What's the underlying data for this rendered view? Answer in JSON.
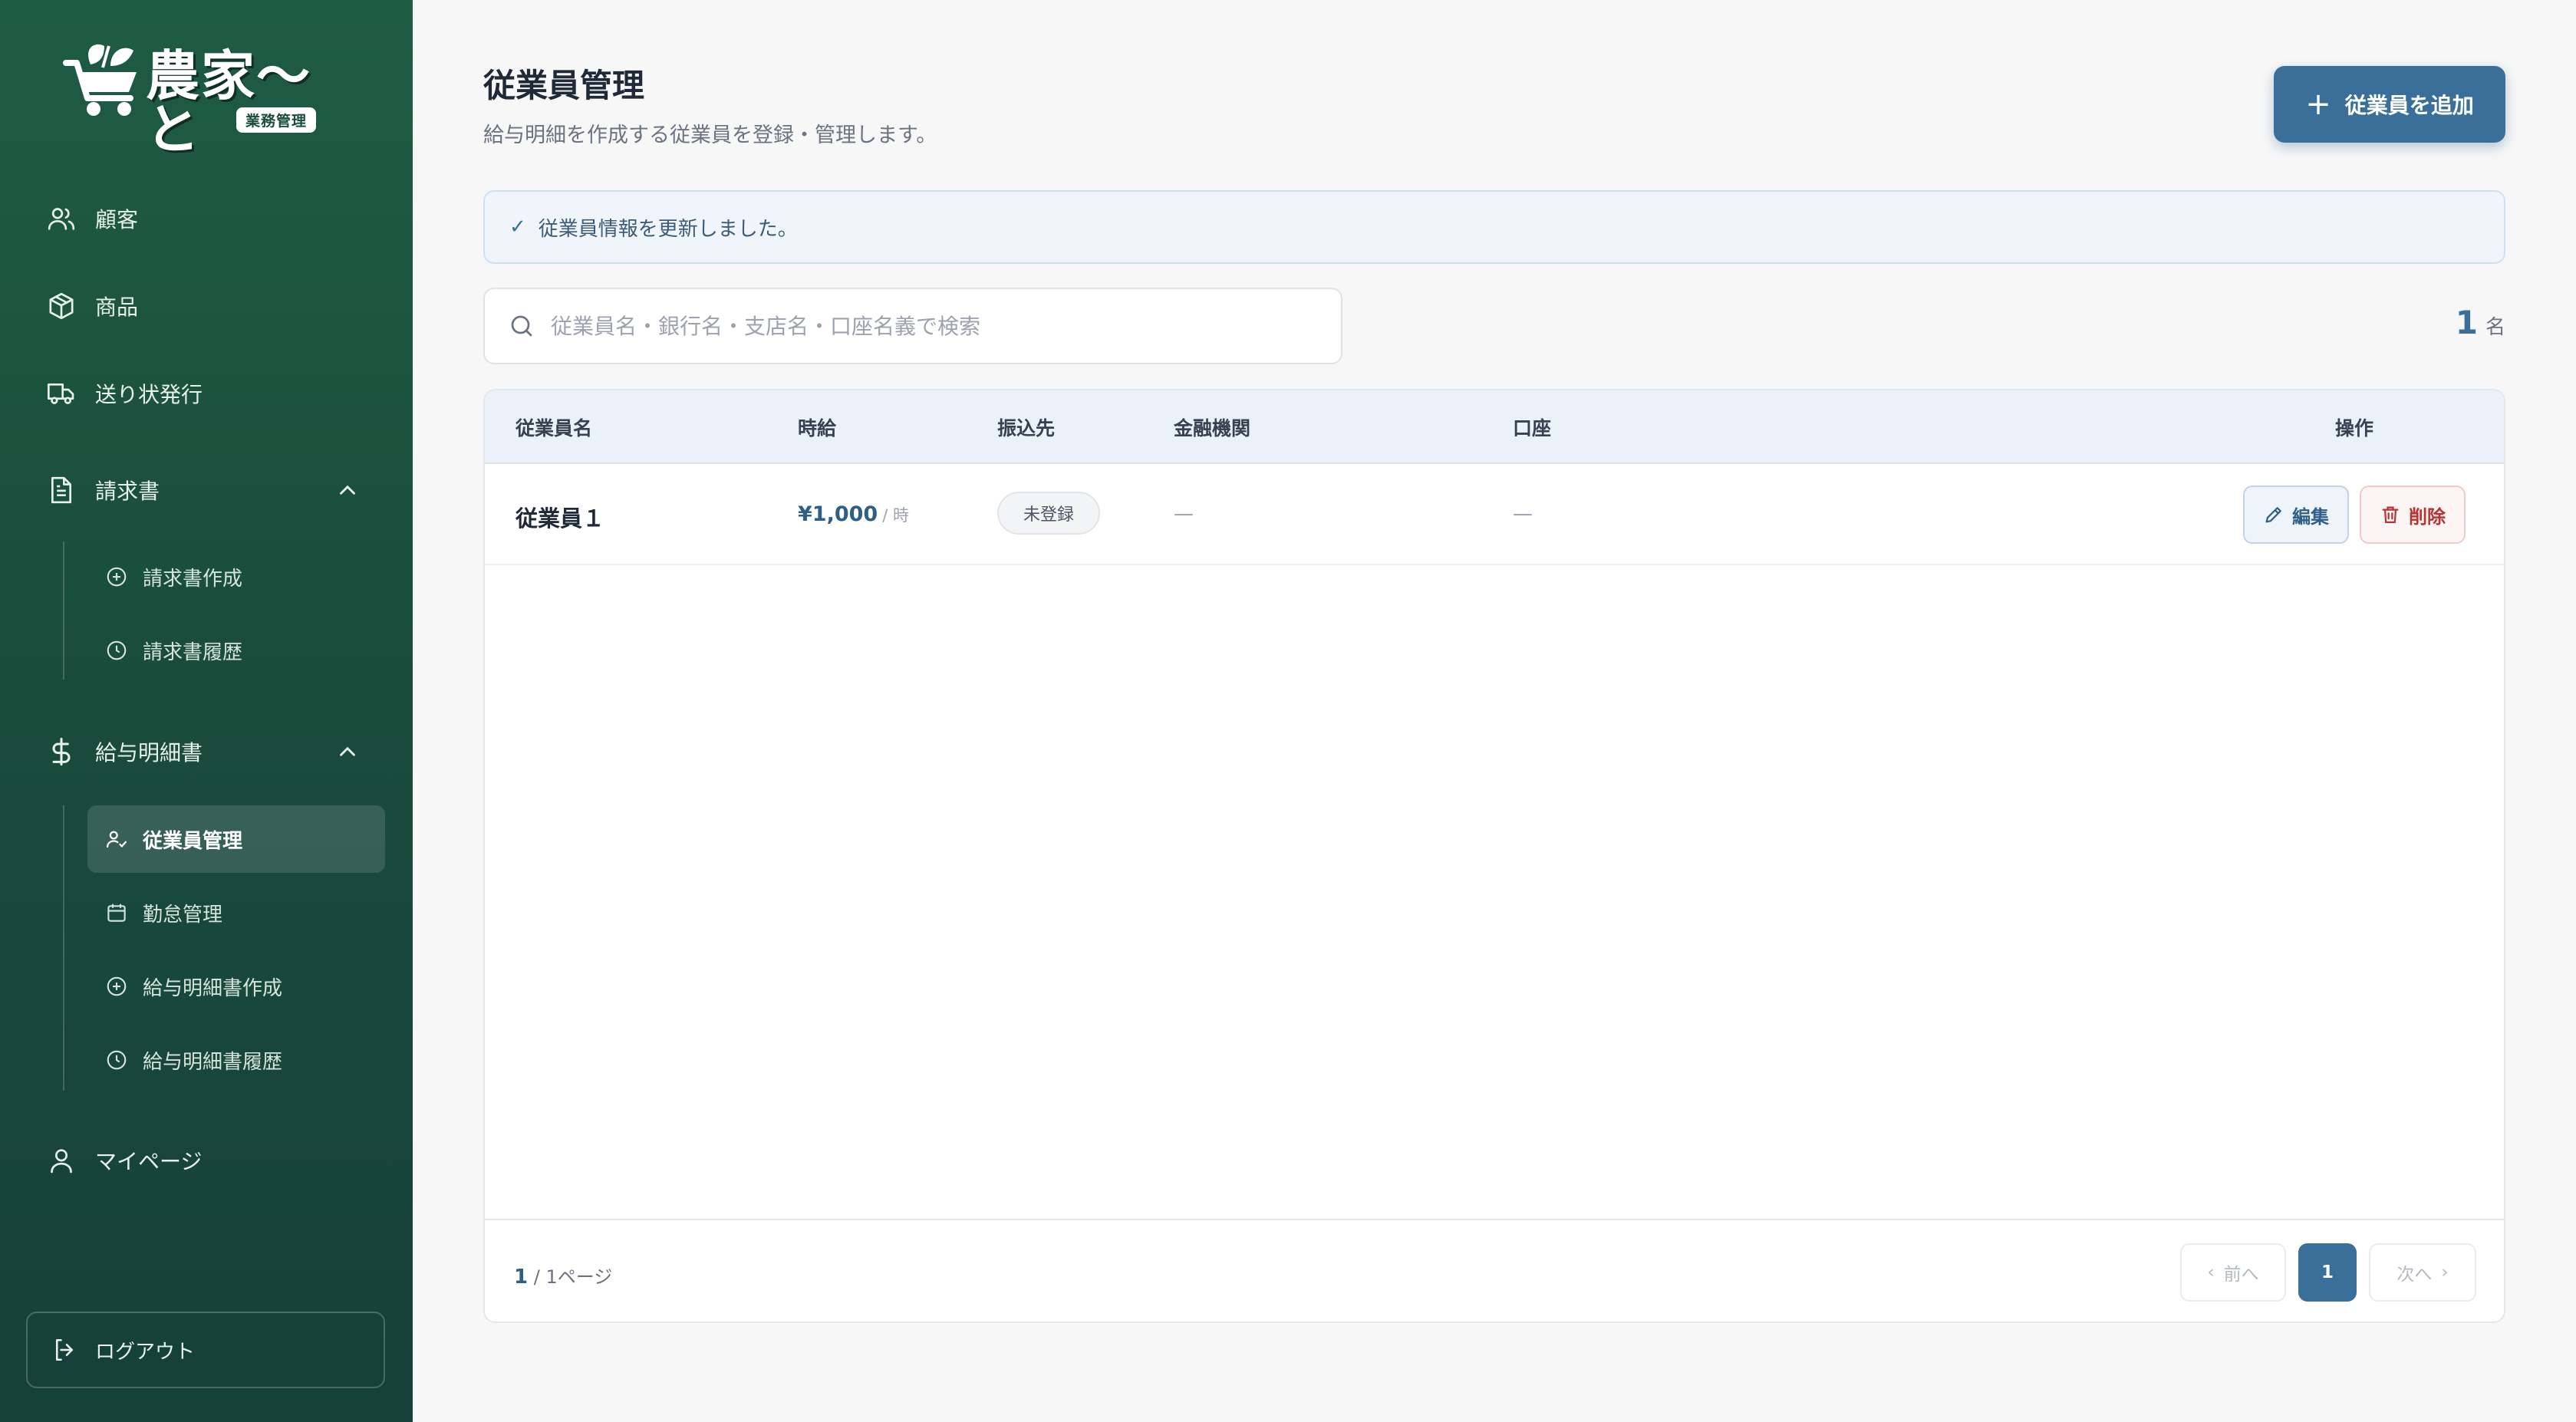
{
  "brand": {
    "name": "農家〜と",
    "sub": "業務管理"
  },
  "sidebar": {
    "items": [
      {
        "label": "顧客"
      },
      {
        "label": "商品"
      },
      {
        "label": "送り状発行"
      },
      {
        "label": "請求書"
      },
      {
        "label": "給与明細書"
      },
      {
        "label": "マイページ"
      }
    ],
    "invoice_sub": [
      {
        "label": "請求書作成"
      },
      {
        "label": "請求書履歴"
      }
    ],
    "payroll_sub": [
      {
        "label": "従業員管理"
      },
      {
        "label": "勤怠管理"
      },
      {
        "label": "給与明細書作成"
      },
      {
        "label": "給与明細書履歴"
      }
    ],
    "logout": "ログアウト"
  },
  "header": {
    "title": "従業員管理",
    "subtitle": "給与明細を作成する従業員を登録・管理します。",
    "add_button": "従業員を追加"
  },
  "alert": {
    "message": "従業員情報を更新しました。"
  },
  "search": {
    "placeholder": "従業員名・銀行名・支店名・口座名義で検索"
  },
  "count": {
    "value": "1",
    "unit": "名"
  },
  "table": {
    "columns": [
      "従業員名",
      "時給",
      "振込先",
      "金融機関",
      "口座",
      "操作"
    ],
    "rows": [
      {
        "name": "従業員１",
        "wage": "¥1,000",
        "wage_unit": "/ 時",
        "transfer": "未登録",
        "bank": "—",
        "account": "—",
        "edit": "編集",
        "delete": "削除"
      }
    ]
  },
  "pagination": {
    "current": "1",
    "total_label": "/ 1ページ",
    "prev": "前へ",
    "next": "次へ",
    "page_button": "1"
  },
  "colors": {
    "sidebar": "#1a4d3c",
    "accent": "#3a6f9a",
    "danger": "#b83232"
  }
}
